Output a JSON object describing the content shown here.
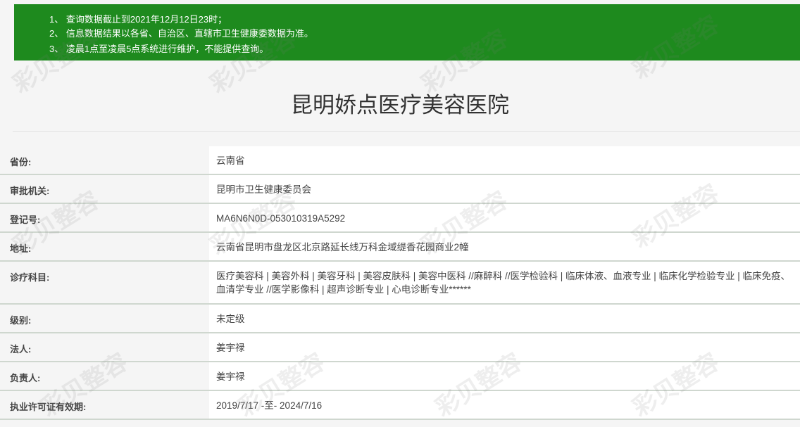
{
  "notice": {
    "lines": [
      "1、 查询数据截止到2021年12月12日23时；",
      "2、 信息数据结果以各省、自治区、直辖市卫生健康委数据为准。",
      "3、 凌晨1点至凌晨5点系统进行维护，不能提供查询。"
    ]
  },
  "hospital": {
    "name": "昆明娇点医疗美容医院"
  },
  "fields": [
    {
      "label": "省份:",
      "value": "云南省"
    },
    {
      "label": "审批机关:",
      "value": "昆明市卫生健康委员会"
    },
    {
      "label": "登记号:",
      "value": "MA6N6N0D-053010319A5292"
    },
    {
      "label": "地址:",
      "value": "云南省昆明市盘龙区北京路延长线万科金域缇香花园商业2幢"
    },
    {
      "label": "诊疗科目:",
      "value": "医疗美容科 | 美容外科 | 美容牙科 | 美容皮肤科 | 美容中医科 //麻醉科 //医学检验科 | 临床体液、血液专业 | 临床化学检验专业 | 临床免疫、血清学专业 //医学影像科 | 超声诊断专业 | 心电诊断专业******"
    },
    {
      "label": "级别:",
      "value": "未定级"
    },
    {
      "label": "法人:",
      "value": "姜宇禄"
    },
    {
      "label": "负责人:",
      "value": "姜宇禄"
    },
    {
      "label": "执业许可证有效期:",
      "value": "2019/7/17 -至- 2024/7/16"
    }
  ],
  "watermark": {
    "text": "彩贝整容",
    "url": "www.cbzr.com"
  }
}
